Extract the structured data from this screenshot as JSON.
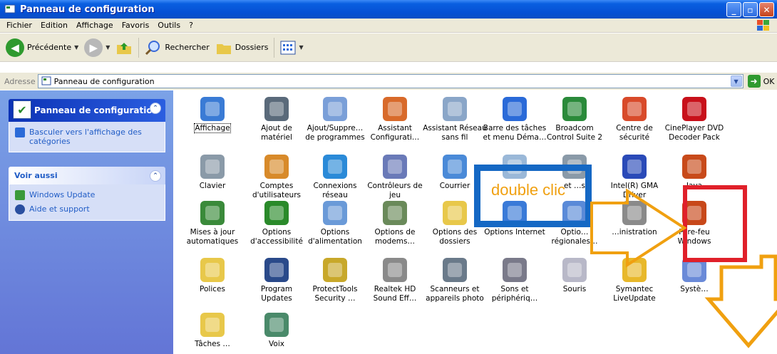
{
  "window": {
    "title": "Panneau de configuration",
    "buttons": {
      "minimize": "_",
      "maximize": "▫",
      "close": "✕"
    }
  },
  "menu": [
    "Fichier",
    "Edition",
    "Affichage",
    "Favoris",
    "Outils",
    "?"
  ],
  "toolbar": {
    "back": "Précédente",
    "search": "Rechercher",
    "folders": "Dossiers"
  },
  "address": {
    "label": "Adresse",
    "value": "Panneau de configuration",
    "go": "OK"
  },
  "left_pane": {
    "control_panel_title": "Panneau de configuration",
    "switch_view": "Basculer vers l'affichage des catégories",
    "see_also_title": "Voir aussi",
    "see_also_items": [
      "Windows Update",
      "Aide et support"
    ]
  },
  "items": [
    {
      "label": "Affichage",
      "color": "#3a7bd5",
      "icon": "display-icon"
    },
    {
      "label": "Ajout de matériel",
      "color": "#5a6a7a",
      "icon": "add-hardware-icon"
    },
    {
      "label": "Ajout/Suppre… de programmes",
      "color": "#7a9fd8",
      "icon": "add-remove-programs-icon"
    },
    {
      "label": "Assistant Configurati…",
      "color": "#d86a2a",
      "icon": "network-setup-icon"
    },
    {
      "label": "Assistant Réseau sans fil",
      "color": "#8aa6c8",
      "icon": "wireless-network-icon"
    },
    {
      "label": "Barre des tâches et menu Déma…",
      "color": "#2a6ad8",
      "icon": "taskbar-icon"
    },
    {
      "label": "Broadcom Control Suite 2",
      "color": "#2a8a3a",
      "icon": "broadcom-icon"
    },
    {
      "label": "Centre de sécurité",
      "color": "#d84a2a",
      "icon": "security-center-icon"
    },
    {
      "label": "CinePlayer DVD Decoder Pack",
      "color": "#c8101a",
      "icon": "cineplayer-icon"
    },
    {
      "label": "Clavier",
      "color": "#8a9aa8",
      "icon": "keyboard-icon"
    },
    {
      "label": "Comptes d'utilisateurs",
      "color": "#d88a2a",
      "icon": "user-accounts-icon"
    },
    {
      "label": "Connexions réseau",
      "color": "#2a8ad8",
      "icon": "network-connections-icon"
    },
    {
      "label": "Contrôleurs de jeu",
      "color": "#6a7ab8",
      "icon": "game-controllers-icon"
    },
    {
      "label": "Courrier",
      "color": "#4a8ad8",
      "icon": "mail-icon"
    },
    {
      "label": "",
      "color": "#9ab8d8",
      "icon": "date-time-icon"
    },
    {
      "label": "et …s",
      "color": "#8a9aa8",
      "icon": "printers-icon"
    },
    {
      "label": "Intel(R) GMA Driver",
      "color": "#2a4ab8",
      "icon": "intel-gma-icon"
    },
    {
      "label": "Java",
      "color": "#c84a1a",
      "icon": "java-icon"
    },
    {
      "label": "Mises à jour automatiques",
      "color": "#3a8a3a",
      "icon": "automatic-updates-icon"
    },
    {
      "label": "Options d'accessibilité",
      "color": "#2a8a2a",
      "icon": "accessibility-icon"
    },
    {
      "label": "Options d'alimentation",
      "color": "#6a9ad8",
      "icon": "power-options-icon"
    },
    {
      "label": "Options de modems…",
      "color": "#6a8a5a",
      "icon": "modem-options-icon"
    },
    {
      "label": "Options des dossiers",
      "color": "#e8c84a",
      "icon": "folder-options-icon"
    },
    {
      "label": "Options Internet",
      "color": "#3a7ad8",
      "icon": "internet-options-icon"
    },
    {
      "label": "Optio… régionales…",
      "color": "#5a8ad8",
      "icon": "regional-options-icon"
    },
    {
      "label": "…inistration",
      "color": "#8a8a8a",
      "icon": "admin-tools-icon"
    },
    {
      "label": "Pare-feu Windows",
      "color": "#c8481a",
      "icon": "firewall-icon"
    },
    {
      "label": "Polices",
      "color": "#e8c84a",
      "icon": "fonts-icon"
    },
    {
      "label": "Program Updates",
      "color": "#2a4a8a",
      "icon": "program-updates-icon"
    },
    {
      "label": "ProtectTools Security …",
      "color": "#c8a82a",
      "icon": "protecttools-icon"
    },
    {
      "label": "Realtek HD Sound Eff…",
      "color": "#8a8a8a",
      "icon": "realtek-sound-icon"
    },
    {
      "label": "Scanneurs et appareils photo",
      "color": "#6a7a8a",
      "icon": "scanners-cameras-icon"
    },
    {
      "label": "Sons et périphériq…",
      "color": "#7a7a8a",
      "icon": "sounds-icon"
    },
    {
      "label": "Souris",
      "color": "#b8b8c8",
      "icon": "mouse-icon"
    },
    {
      "label": "Symantec LiveUpdate",
      "color": "#e8b82a",
      "icon": "symantec-icon"
    },
    {
      "label": "Systè…",
      "color": "#6a8ad8",
      "icon": "system-icon"
    },
    {
      "label": "Tâches …",
      "color": "#e8c84a",
      "icon": "scheduled-tasks-icon"
    },
    {
      "label": "Voix",
      "color": "#4a8a6a",
      "icon": "speech-icon"
    }
  ],
  "annotation": {
    "text": "double clic",
    "colors": {
      "box": "#1568c4",
      "text": "#f0a010",
      "highlight": "#e0202a",
      "arrow": "#f0a010"
    }
  }
}
